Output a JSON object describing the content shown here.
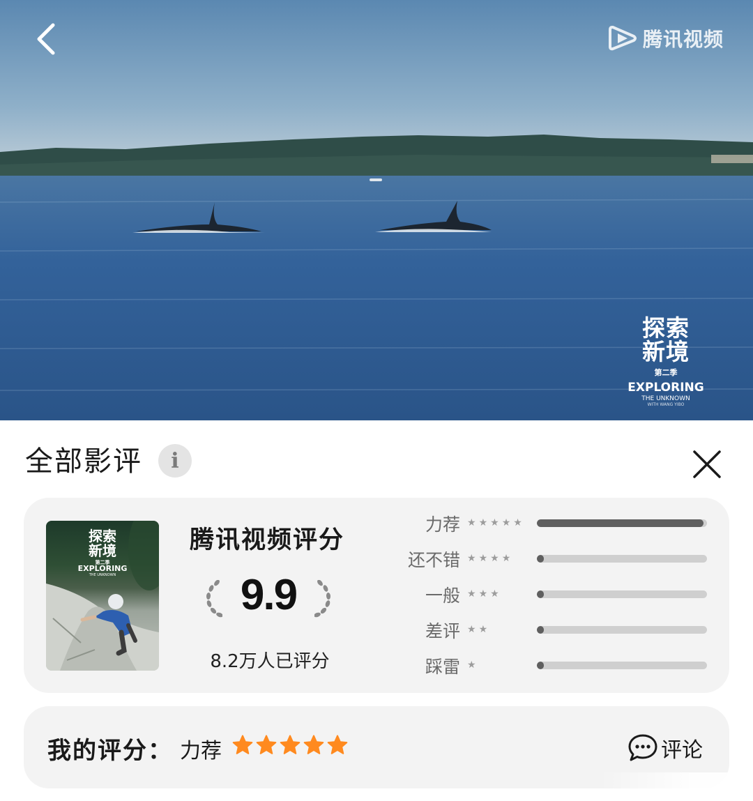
{
  "video": {
    "brand_name": "腾讯视频",
    "show_logo": {
      "title_line1": "探索",
      "title_line2": "新境",
      "season": "第二季",
      "en_title": "EXPLORING",
      "en_subtitle": "THE UNKNOWN",
      "en_credit": "WITH WANG YIBO"
    },
    "back_icon": "chevron-left-icon",
    "brand_icon": "tencent-video-logo"
  },
  "reviews": {
    "title": "全部影评",
    "info_icon_glyph": "i",
    "close_icon": "close-icon"
  },
  "rating": {
    "poster": {
      "title_line1": "探索",
      "title_line2": "新境",
      "season": "第二季",
      "en_title": "EXPLORING",
      "en_subtitle": "THE UNKNOWN"
    },
    "source_title": "腾讯视频评分",
    "score": "9.9",
    "count_text": "8.2万人已评分",
    "distribution": [
      {
        "label": "力荐",
        "stars": 5,
        "fraction": 0.98
      },
      {
        "label": "还不错",
        "stars": 4,
        "fraction": 0.02
      },
      {
        "label": "一般",
        "stars": 3,
        "fraction": 0.02
      },
      {
        "label": "差评",
        "stars": 2,
        "fraction": 0.02
      },
      {
        "label": "踩雷",
        "stars": 1,
        "fraction": 0.02
      }
    ],
    "bar_color": "#5f5f5f",
    "bar_track_color": "#cfcfcf"
  },
  "my_rating": {
    "label": "我的评分：",
    "value": "力荐",
    "stars": 5,
    "star_color": "#ff8a1f",
    "comment_label": "评论",
    "comment_icon": "chat-bubble-icon"
  }
}
